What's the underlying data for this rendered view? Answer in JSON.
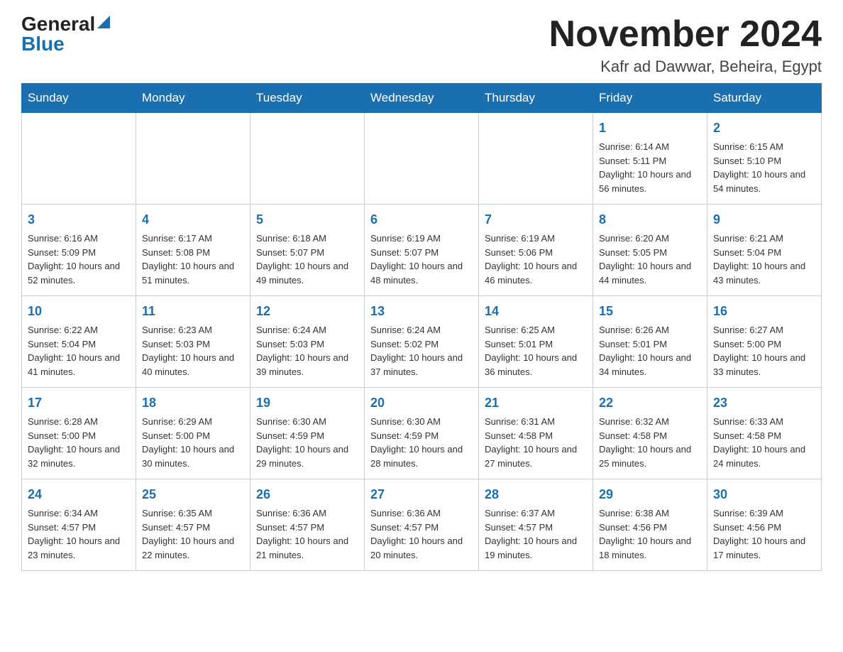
{
  "logo": {
    "general": "General",
    "blue": "Blue"
  },
  "title": "November 2024",
  "location": "Kafr ad Dawwar, Beheira, Egypt",
  "weekdays": [
    "Sunday",
    "Monday",
    "Tuesday",
    "Wednesday",
    "Thursday",
    "Friday",
    "Saturday"
  ],
  "weeks": [
    [
      {
        "day": "",
        "info": ""
      },
      {
        "day": "",
        "info": ""
      },
      {
        "day": "",
        "info": ""
      },
      {
        "day": "",
        "info": ""
      },
      {
        "day": "",
        "info": ""
      },
      {
        "day": "1",
        "info": "Sunrise: 6:14 AM\nSunset: 5:11 PM\nDaylight: 10 hours and 56 minutes."
      },
      {
        "day": "2",
        "info": "Sunrise: 6:15 AM\nSunset: 5:10 PM\nDaylight: 10 hours and 54 minutes."
      }
    ],
    [
      {
        "day": "3",
        "info": "Sunrise: 6:16 AM\nSunset: 5:09 PM\nDaylight: 10 hours and 52 minutes."
      },
      {
        "day": "4",
        "info": "Sunrise: 6:17 AM\nSunset: 5:08 PM\nDaylight: 10 hours and 51 minutes."
      },
      {
        "day": "5",
        "info": "Sunrise: 6:18 AM\nSunset: 5:07 PM\nDaylight: 10 hours and 49 minutes."
      },
      {
        "day": "6",
        "info": "Sunrise: 6:19 AM\nSunset: 5:07 PM\nDaylight: 10 hours and 48 minutes."
      },
      {
        "day": "7",
        "info": "Sunrise: 6:19 AM\nSunset: 5:06 PM\nDaylight: 10 hours and 46 minutes."
      },
      {
        "day": "8",
        "info": "Sunrise: 6:20 AM\nSunset: 5:05 PM\nDaylight: 10 hours and 44 minutes."
      },
      {
        "day": "9",
        "info": "Sunrise: 6:21 AM\nSunset: 5:04 PM\nDaylight: 10 hours and 43 minutes."
      }
    ],
    [
      {
        "day": "10",
        "info": "Sunrise: 6:22 AM\nSunset: 5:04 PM\nDaylight: 10 hours and 41 minutes."
      },
      {
        "day": "11",
        "info": "Sunrise: 6:23 AM\nSunset: 5:03 PM\nDaylight: 10 hours and 40 minutes."
      },
      {
        "day": "12",
        "info": "Sunrise: 6:24 AM\nSunset: 5:03 PM\nDaylight: 10 hours and 39 minutes."
      },
      {
        "day": "13",
        "info": "Sunrise: 6:24 AM\nSunset: 5:02 PM\nDaylight: 10 hours and 37 minutes."
      },
      {
        "day": "14",
        "info": "Sunrise: 6:25 AM\nSunset: 5:01 PM\nDaylight: 10 hours and 36 minutes."
      },
      {
        "day": "15",
        "info": "Sunrise: 6:26 AM\nSunset: 5:01 PM\nDaylight: 10 hours and 34 minutes."
      },
      {
        "day": "16",
        "info": "Sunrise: 6:27 AM\nSunset: 5:00 PM\nDaylight: 10 hours and 33 minutes."
      }
    ],
    [
      {
        "day": "17",
        "info": "Sunrise: 6:28 AM\nSunset: 5:00 PM\nDaylight: 10 hours and 32 minutes."
      },
      {
        "day": "18",
        "info": "Sunrise: 6:29 AM\nSunset: 5:00 PM\nDaylight: 10 hours and 30 minutes."
      },
      {
        "day": "19",
        "info": "Sunrise: 6:30 AM\nSunset: 4:59 PM\nDaylight: 10 hours and 29 minutes."
      },
      {
        "day": "20",
        "info": "Sunrise: 6:30 AM\nSunset: 4:59 PM\nDaylight: 10 hours and 28 minutes."
      },
      {
        "day": "21",
        "info": "Sunrise: 6:31 AM\nSunset: 4:58 PM\nDaylight: 10 hours and 27 minutes."
      },
      {
        "day": "22",
        "info": "Sunrise: 6:32 AM\nSunset: 4:58 PM\nDaylight: 10 hours and 25 minutes."
      },
      {
        "day": "23",
        "info": "Sunrise: 6:33 AM\nSunset: 4:58 PM\nDaylight: 10 hours and 24 minutes."
      }
    ],
    [
      {
        "day": "24",
        "info": "Sunrise: 6:34 AM\nSunset: 4:57 PM\nDaylight: 10 hours and 23 minutes."
      },
      {
        "day": "25",
        "info": "Sunrise: 6:35 AM\nSunset: 4:57 PM\nDaylight: 10 hours and 22 minutes."
      },
      {
        "day": "26",
        "info": "Sunrise: 6:36 AM\nSunset: 4:57 PM\nDaylight: 10 hours and 21 minutes."
      },
      {
        "day": "27",
        "info": "Sunrise: 6:36 AM\nSunset: 4:57 PM\nDaylight: 10 hours and 20 minutes."
      },
      {
        "day": "28",
        "info": "Sunrise: 6:37 AM\nSunset: 4:57 PM\nDaylight: 10 hours and 19 minutes."
      },
      {
        "day": "29",
        "info": "Sunrise: 6:38 AM\nSunset: 4:56 PM\nDaylight: 10 hours and 18 minutes."
      },
      {
        "day": "30",
        "info": "Sunrise: 6:39 AM\nSunset: 4:56 PM\nDaylight: 10 hours and 17 minutes."
      }
    ]
  ]
}
